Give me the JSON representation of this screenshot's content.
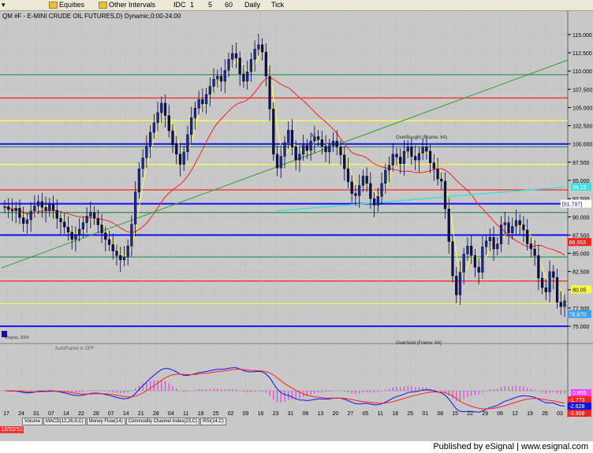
{
  "toolbar": {
    "equities": "Equities",
    "other_intervals": "Other Intervals",
    "intervals": [
      "IDC",
      "1",
      "5",
      "60",
      "Daily",
      "Tick"
    ]
  },
  "chart_title": "QM #F - E-MINI CRUDE OIL FUTURES,D) Dynamic,0:00-24:00",
  "chart_data": {
    "type": "candlestick",
    "title": "QM #F - E-MINI CRUDE OIL FUTURES,D) Dynamic,0:00-24:00",
    "ylim": [
      73.5,
      116.5
    ],
    "y_ticks": [
      "115.000",
      "112.500",
      "110.000",
      "107.500",
      "105.000",
      "102.500",
      "100.000",
      "97.500",
      "95.000",
      "92.500",
      "90.000",
      "87.500",
      "85.000",
      "82.500",
      "80.000",
      "77.500",
      "75.000"
    ],
    "x_labels": [
      "17",
      "24",
      "31",
      "07",
      "14",
      "22",
      "28",
      "07",
      "14",
      "21",
      "28",
      "04",
      "11",
      "18",
      "25",
      "02",
      "09",
      "16",
      "23",
      "31",
      "06",
      "13",
      "20",
      "27",
      "05",
      "11",
      "18",
      "25",
      "01",
      "08",
      "15",
      "22",
      "29",
      "06",
      "12",
      "19",
      "26",
      "03"
    ],
    "month_labels": [
      "2011",
      "Feb",
      "Mar",
      "Apr",
      "May",
      "Jun",
      "Jul",
      "Aug",
      "Sep",
      "Oct"
    ],
    "closes": [
      91.4,
      91.0,
      90.8,
      91.2,
      89.9,
      89.1,
      89.6,
      90.8,
      91.5,
      92.1,
      91.3,
      90.9,
      91.7,
      90.9,
      89.8,
      89.3,
      88.6,
      87.9,
      86.9,
      87.5,
      88.3,
      89.2,
      90.1,
      90.6,
      89.8,
      88.9,
      87.8,
      86.9,
      86.2,
      85.3,
      84.7,
      84.1,
      84.5,
      86.0,
      89.0,
      93.4,
      96.6,
      98.1,
      99.7,
      101.6,
      102.9,
      104.3,
      105.6,
      103.9,
      101.8,
      99.9,
      98.6,
      97.2,
      98.9,
      101.3,
      103.6,
      104.9,
      106.1,
      105.5,
      106.8,
      107.9,
      108.9,
      109.3,
      108.6,
      110.1,
      111.6,
      112.4,
      111.8,
      109.6,
      108.6,
      109.9,
      111.6,
      113.0,
      113.6,
      112.6,
      109.3,
      104.8,
      98.6,
      96.7,
      98.3,
      100.2,
      101.9,
      99.6,
      97.8,
      98.6,
      99.8,
      99.1,
      100.4,
      101.0,
      100.6,
      99.7,
      98.9,
      99.8,
      100.4,
      99.6,
      98.5,
      96.6,
      94.8,
      93.2,
      92.9,
      94.3,
      95.6,
      94.6,
      92.5,
      91.6,
      92.8,
      94.6,
      96.4,
      97.1,
      98.6,
      98.2,
      97.3,
      99.0,
      99.6,
      98.3,
      97.8,
      98.7,
      99.6,
      99.0,
      97.4,
      96.6,
      95.2,
      94.9,
      91.1,
      86.6,
      81.9,
      79.3,
      82.4,
      84.9,
      86.0,
      84.7,
      83.1,
      82.4,
      85.9,
      86.7,
      87.2,
      85.6,
      86.3,
      88.9,
      89.2,
      87.8,
      88.7,
      89.5,
      88.9,
      88.2,
      86.3,
      85.6,
      84.7,
      81.6,
      80.3,
      79.7,
      82.5,
      81.7,
      78.3,
      77.7,
      78.5
    ],
    "horizontal_levels": [
      {
        "value": 109.5,
        "color": "#2e8b57"
      },
      {
        "value": 106.3,
        "color": "#ff2020"
      },
      {
        "value": 103.2,
        "color": "#ffff40"
      },
      {
        "value": 100.0,
        "color": "#1010ff"
      },
      {
        "value": 99.6,
        "color": "#2e8b57"
      },
      {
        "value": 97.2,
        "color": "#ffff40"
      },
      {
        "value": 93.7,
        "color": "#ff2020"
      },
      {
        "value": 91.8,
        "color": "#1010ff"
      },
      {
        "value": 90.6,
        "color": "#2e8b57"
      },
      {
        "value": 87.5,
        "color": "#1010ff"
      },
      {
        "value": 84.5,
        "color": "#2e8b57"
      },
      {
        "value": 81.2,
        "color": "#ff2020"
      },
      {
        "value": 78.1,
        "color": "#ffff40"
      },
      {
        "value": 75.0,
        "color": "#1010ff"
      }
    ],
    "annotations": [
      "OverBought (Frame: 64)",
      "OverSold (Frame: 64)",
      "AutoFrame is OFF",
      "H"
    ],
    "price_flags": [
      {
        "label": "[91.797]",
        "value": 91.8,
        "color": "#1010ff",
        "bg": "#ffffff"
      },
      {
        "label": "94.12",
        "value": 94.12,
        "color": "#ffffff",
        "bg": "#40e0e0"
      },
      {
        "label": "86.553",
        "value": 86.553,
        "color": "#ffffff",
        "bg": "#ff2020"
      },
      {
        "label": "80.05",
        "value": 80.05,
        "color": "#000000",
        "bg": "#ffff40"
      },
      {
        "label": "76.670",
        "value": 76.67,
        "color": "#ffffff",
        "bg": "#40a0ff"
      }
    ],
    "macd_flags": [
      {
        "label": "0.855",
        "color": "#ffffff",
        "bg": "#ff40ff"
      },
      {
        "label": "-1.773",
        "color": "#ffffff",
        "bg": "#ff2020"
      },
      {
        "label": "-2.628",
        "color": "#ffffff",
        "bg": "#1010ff"
      },
      {
        "label": "-3.908",
        "color": "#ffffff",
        "bg": "#ff2020"
      }
    ],
    "ma_colors": {
      "fast": "#ffff40",
      "slow": "#ff2020",
      "trend": "#2ea02e",
      "cyan": "#40e0e0"
    }
  },
  "watermark": "eSignal, 2009",
  "tabs": [
    "Volume",
    "MACD(12,26,9,C)",
    "Money Flow(14)",
    "Commodity Channel Index(23,C)",
    "RSI(14,C)"
  ],
  "date_box": "12/22/10",
  "published": "Published by eSignal | www.esignal.com"
}
